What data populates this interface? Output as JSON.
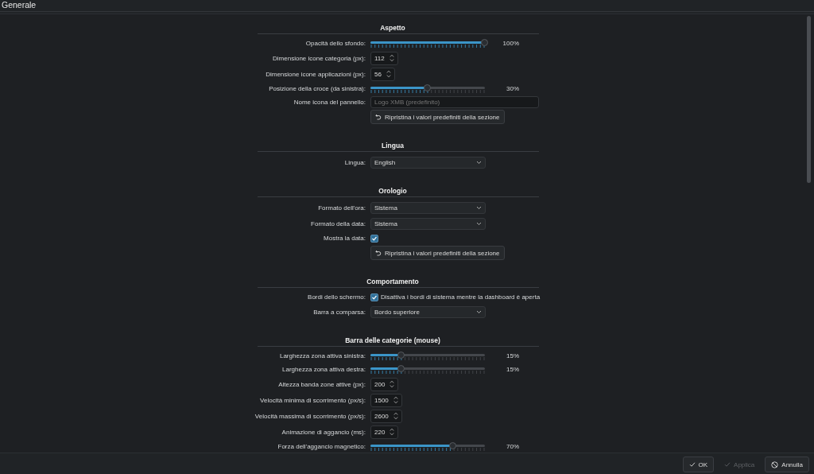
{
  "window": {
    "title": "Generale"
  },
  "sections": [
    {
      "title": "Aspetto",
      "rows": [
        {
          "kind": "slider",
          "label": "Opacità dello sfondo:",
          "level": 1,
          "reading": "100%"
        },
        {
          "kind": "spin",
          "label": "Dimensione icone categoria (px):",
          "value": "112"
        },
        {
          "kind": "spin",
          "label": "Dimensione icone applicazioni (px):",
          "value": "56"
        },
        {
          "kind": "slider",
          "label": "Posizione della croce (da sinistra):",
          "level": 0.5,
          "reading": "30%"
        },
        {
          "kind": "text",
          "label": "Nome icona del pannello:",
          "placeholder": "Logo XMB (predefinito)"
        },
        {
          "kind": "button",
          "text": "Ripristina i valori predefiniti della sezione"
        }
      ]
    },
    {
      "title": "Lingua",
      "rows": [
        {
          "kind": "combo",
          "label": "Lingua:",
          "value": "English"
        }
      ]
    },
    {
      "title": "Orologio",
      "rows": [
        {
          "kind": "combo",
          "label": "Formato dell'ora:",
          "value": "Sistema"
        },
        {
          "kind": "combo",
          "label": "Formato della data:",
          "value": "Sistema"
        },
        {
          "kind": "checkbox",
          "label": "Mostra la data:",
          "checked": true
        },
        {
          "kind": "button",
          "text": "Ripristina i valori predefiniti della sezione"
        }
      ]
    },
    {
      "title": "Comportamento",
      "rows": [
        {
          "kind": "checkbox",
          "label": "Bordi dello schermo:",
          "checked": true,
          "text": "Disattiva i bordi di sistema mentre la dashboard è aperta"
        },
        {
          "kind": "combo",
          "label": "Barra a comparsa:",
          "value": "Bordo superiore"
        }
      ]
    },
    {
      "title": "Barra delle categorie (mouse)",
      "rows": [
        {
          "kind": "slider",
          "label": "Larghezza zona attiva sinistra:",
          "level": 0.27,
          "reading": "15%"
        },
        {
          "kind": "slider",
          "label": "Larghezza zona attiva destra:",
          "level": 0.27,
          "reading": "15%"
        },
        {
          "kind": "spin",
          "label": "Altezza banda zone attive (px):",
          "value": "200"
        },
        {
          "kind": "spin",
          "label": "Velocità minima di scorrimento (px/s):",
          "value": "1500"
        },
        {
          "kind": "spin",
          "label": "Velocità massima di scorrimento (px/s):",
          "value": "2600"
        },
        {
          "kind": "spin",
          "label": "Animazione di aggancio (ms):",
          "value": "220"
        },
        {
          "kind": "slider",
          "label": "Forza dell'aggancio magnetico:",
          "level": 0.72,
          "reading": "70%"
        }
      ]
    }
  ],
  "buttons": [
    {
      "kind": "confirm",
      "text": "OK",
      "disabled": false
    },
    {
      "kind": "confirm",
      "text": "Applica",
      "disabled": true
    },
    {
      "kind": "cancel",
      "text": "Annulla",
      "disabled": false
    }
  ]
}
